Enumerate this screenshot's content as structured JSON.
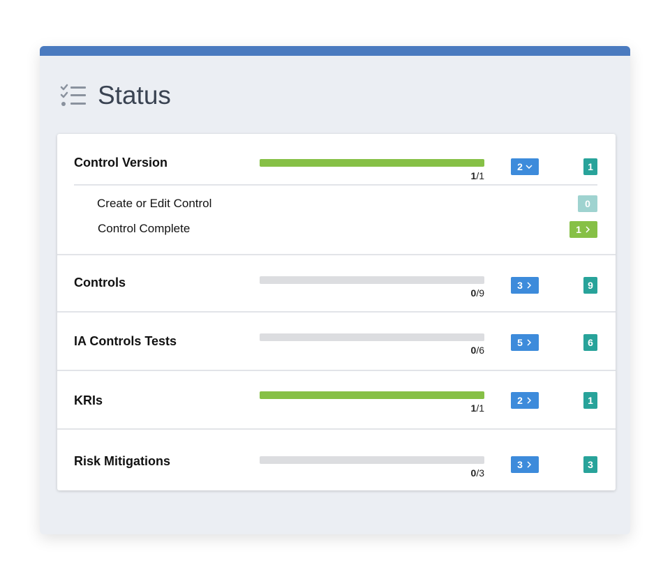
{
  "header": {
    "title": "Status",
    "icon": "checklist-icon"
  },
  "colors": {
    "accent": "#4a7abf",
    "progress_fill": "#86c046",
    "blue_badge": "#3d8bdb",
    "teal_badge": "#28a39a"
  },
  "rows": [
    {
      "name": "Control Version",
      "progress": {
        "done": "1",
        "total": "/1",
        "fraction": 1.0
      },
      "action_count": "2",
      "action_chevron": "chevron-down-icon",
      "count": "1",
      "subitems": [
        {
          "label": "Create or Edit Control",
          "count": "0"
        },
        {
          "label": "Control Complete",
          "count": "1"
        }
      ]
    },
    {
      "name": "Controls",
      "progress": {
        "done": "0",
        "total": "/9",
        "fraction": 0.0
      },
      "action_count": "3",
      "action_chevron": "chevron-right-icon",
      "count": "9"
    },
    {
      "name": "IA Controls Tests",
      "progress": {
        "done": "0",
        "total": "/6",
        "fraction": 0.0
      },
      "action_count": "5",
      "action_chevron": "chevron-right-icon",
      "count": "6"
    },
    {
      "name": "KRIs",
      "progress": {
        "done": "1",
        "total": "/1",
        "fraction": 1.0
      },
      "action_count": "2",
      "action_chevron": "chevron-right-icon",
      "count": "1"
    },
    {
      "name": "Risk Mitigations",
      "progress": {
        "done": "0",
        "total": "/3",
        "fraction": 0.0
      },
      "action_count": "3",
      "action_chevron": "chevron-right-icon",
      "count": "3"
    }
  ]
}
